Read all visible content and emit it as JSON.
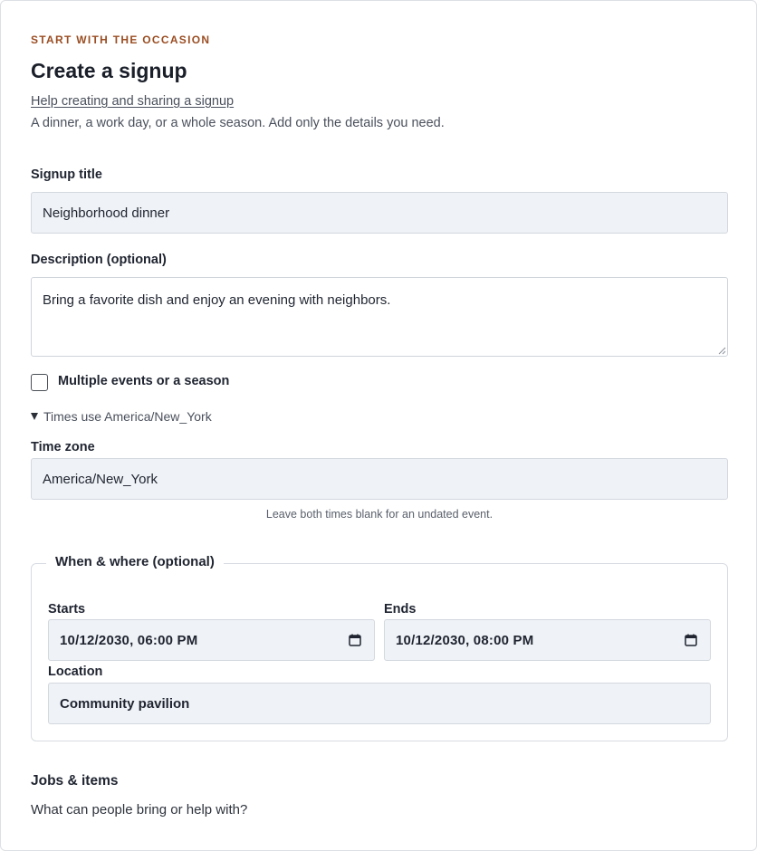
{
  "header": {
    "eyebrow": "START WITH THE OCCASION",
    "title": "Create a signup",
    "help_link": "Help creating and sharing a signup",
    "subtitle": "A dinner, a work day, or a whole season. Add only the details you need."
  },
  "form": {
    "title_label": "Signup title",
    "title_value": "Neighborhood dinner",
    "description_label": "Description (optional)",
    "description_value": "Bring a favorite dish and enjoy an evening with neighbors.",
    "multiple_label": "Multiple events or a season",
    "multiple_checked": false,
    "timezone_disclosure": "Times use America/New_York",
    "timezone_label": "Time zone",
    "timezone_value": "America/New_York",
    "hint": "Leave both times blank for an undated event."
  },
  "when_where": {
    "legend": "When & where (optional)",
    "starts_label": "Starts",
    "starts_value": "10/12/2030, 06:00 PM",
    "ends_label": "Ends",
    "ends_value": "10/12/2030, 08:00 PM",
    "location_label": "Location",
    "location_value": "Community pavilion"
  },
  "jobs": {
    "heading": "Jobs & items",
    "subheading": "What can people bring or help with?"
  },
  "colors": {
    "accent": "#9a4d22",
    "input_bg": "#eff2f6",
    "border": "#d3d8df"
  },
  "icons": {
    "calendar": "calendar-icon",
    "disclosure": "triangle-down-icon"
  }
}
